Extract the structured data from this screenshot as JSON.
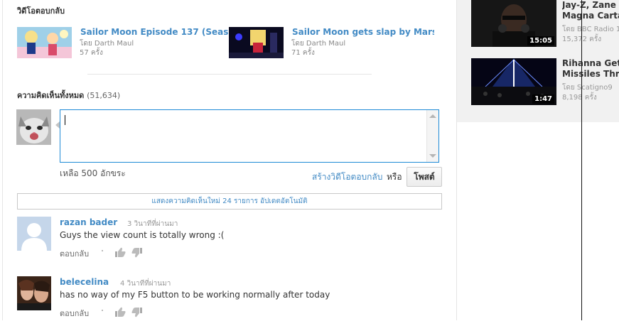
{
  "related": {
    "heading": "วิดีโอตอบกลับ",
    "videos": [
      {
        "title": "Sailor Moon Episode 137 (Seas…",
        "by": "โดย Darth Maul",
        "views": "57 ครั้ง"
      },
      {
        "title": "Sailor Moon gets slap by Mars",
        "by": "โดย Darth Maul",
        "views": "71 ครั้ง"
      }
    ]
  },
  "comments_section": {
    "heading": "ความคิดเห็นทั้งหมด",
    "count": "(51,634)"
  },
  "composer": {
    "value": "",
    "chars_left": "เหลือ 500 อักขระ",
    "create_video_response": "สร้างวิดีโอตอบกลับ",
    "or": "หรือ",
    "post_label": "โพสต์"
  },
  "new_comments_bar": "แสดงความคิดเห็นใหม่ 24 รายการ อัปเดตอัตโนมัติ",
  "comments": [
    {
      "user": "razan bader",
      "time": "3 วินาทีที่ผ่านมา",
      "text": "Guys the view count is totally wrong :(",
      "reply": "ตอบกลับ"
    },
    {
      "user": "belecelina",
      "time": "4 วินาทีที่ผ่านมา",
      "text": "has no way of my F5 button to be working normally after today",
      "reply": "ตอบกลับ"
    }
  ],
  "sidebar": {
    "videos": [
      {
        "title_line1": "Jay-Z, Zane L",
        "title_line2": "Magna Carta",
        "by": "โดย BBC Radio 1",
        "views": "15,372 ครั้ง",
        "duration": "15:05"
      },
      {
        "title_line1": "Rihanna Gets",
        "title_line2": "Missiles Thro",
        "by": "โดย Scatigno9",
        "views": "8,198 ครั้ง",
        "duration": "1:47"
      }
    ]
  },
  "icons": {
    "like": "thumbs-up-icon",
    "dislike": "thumbs-down-icon"
  }
}
